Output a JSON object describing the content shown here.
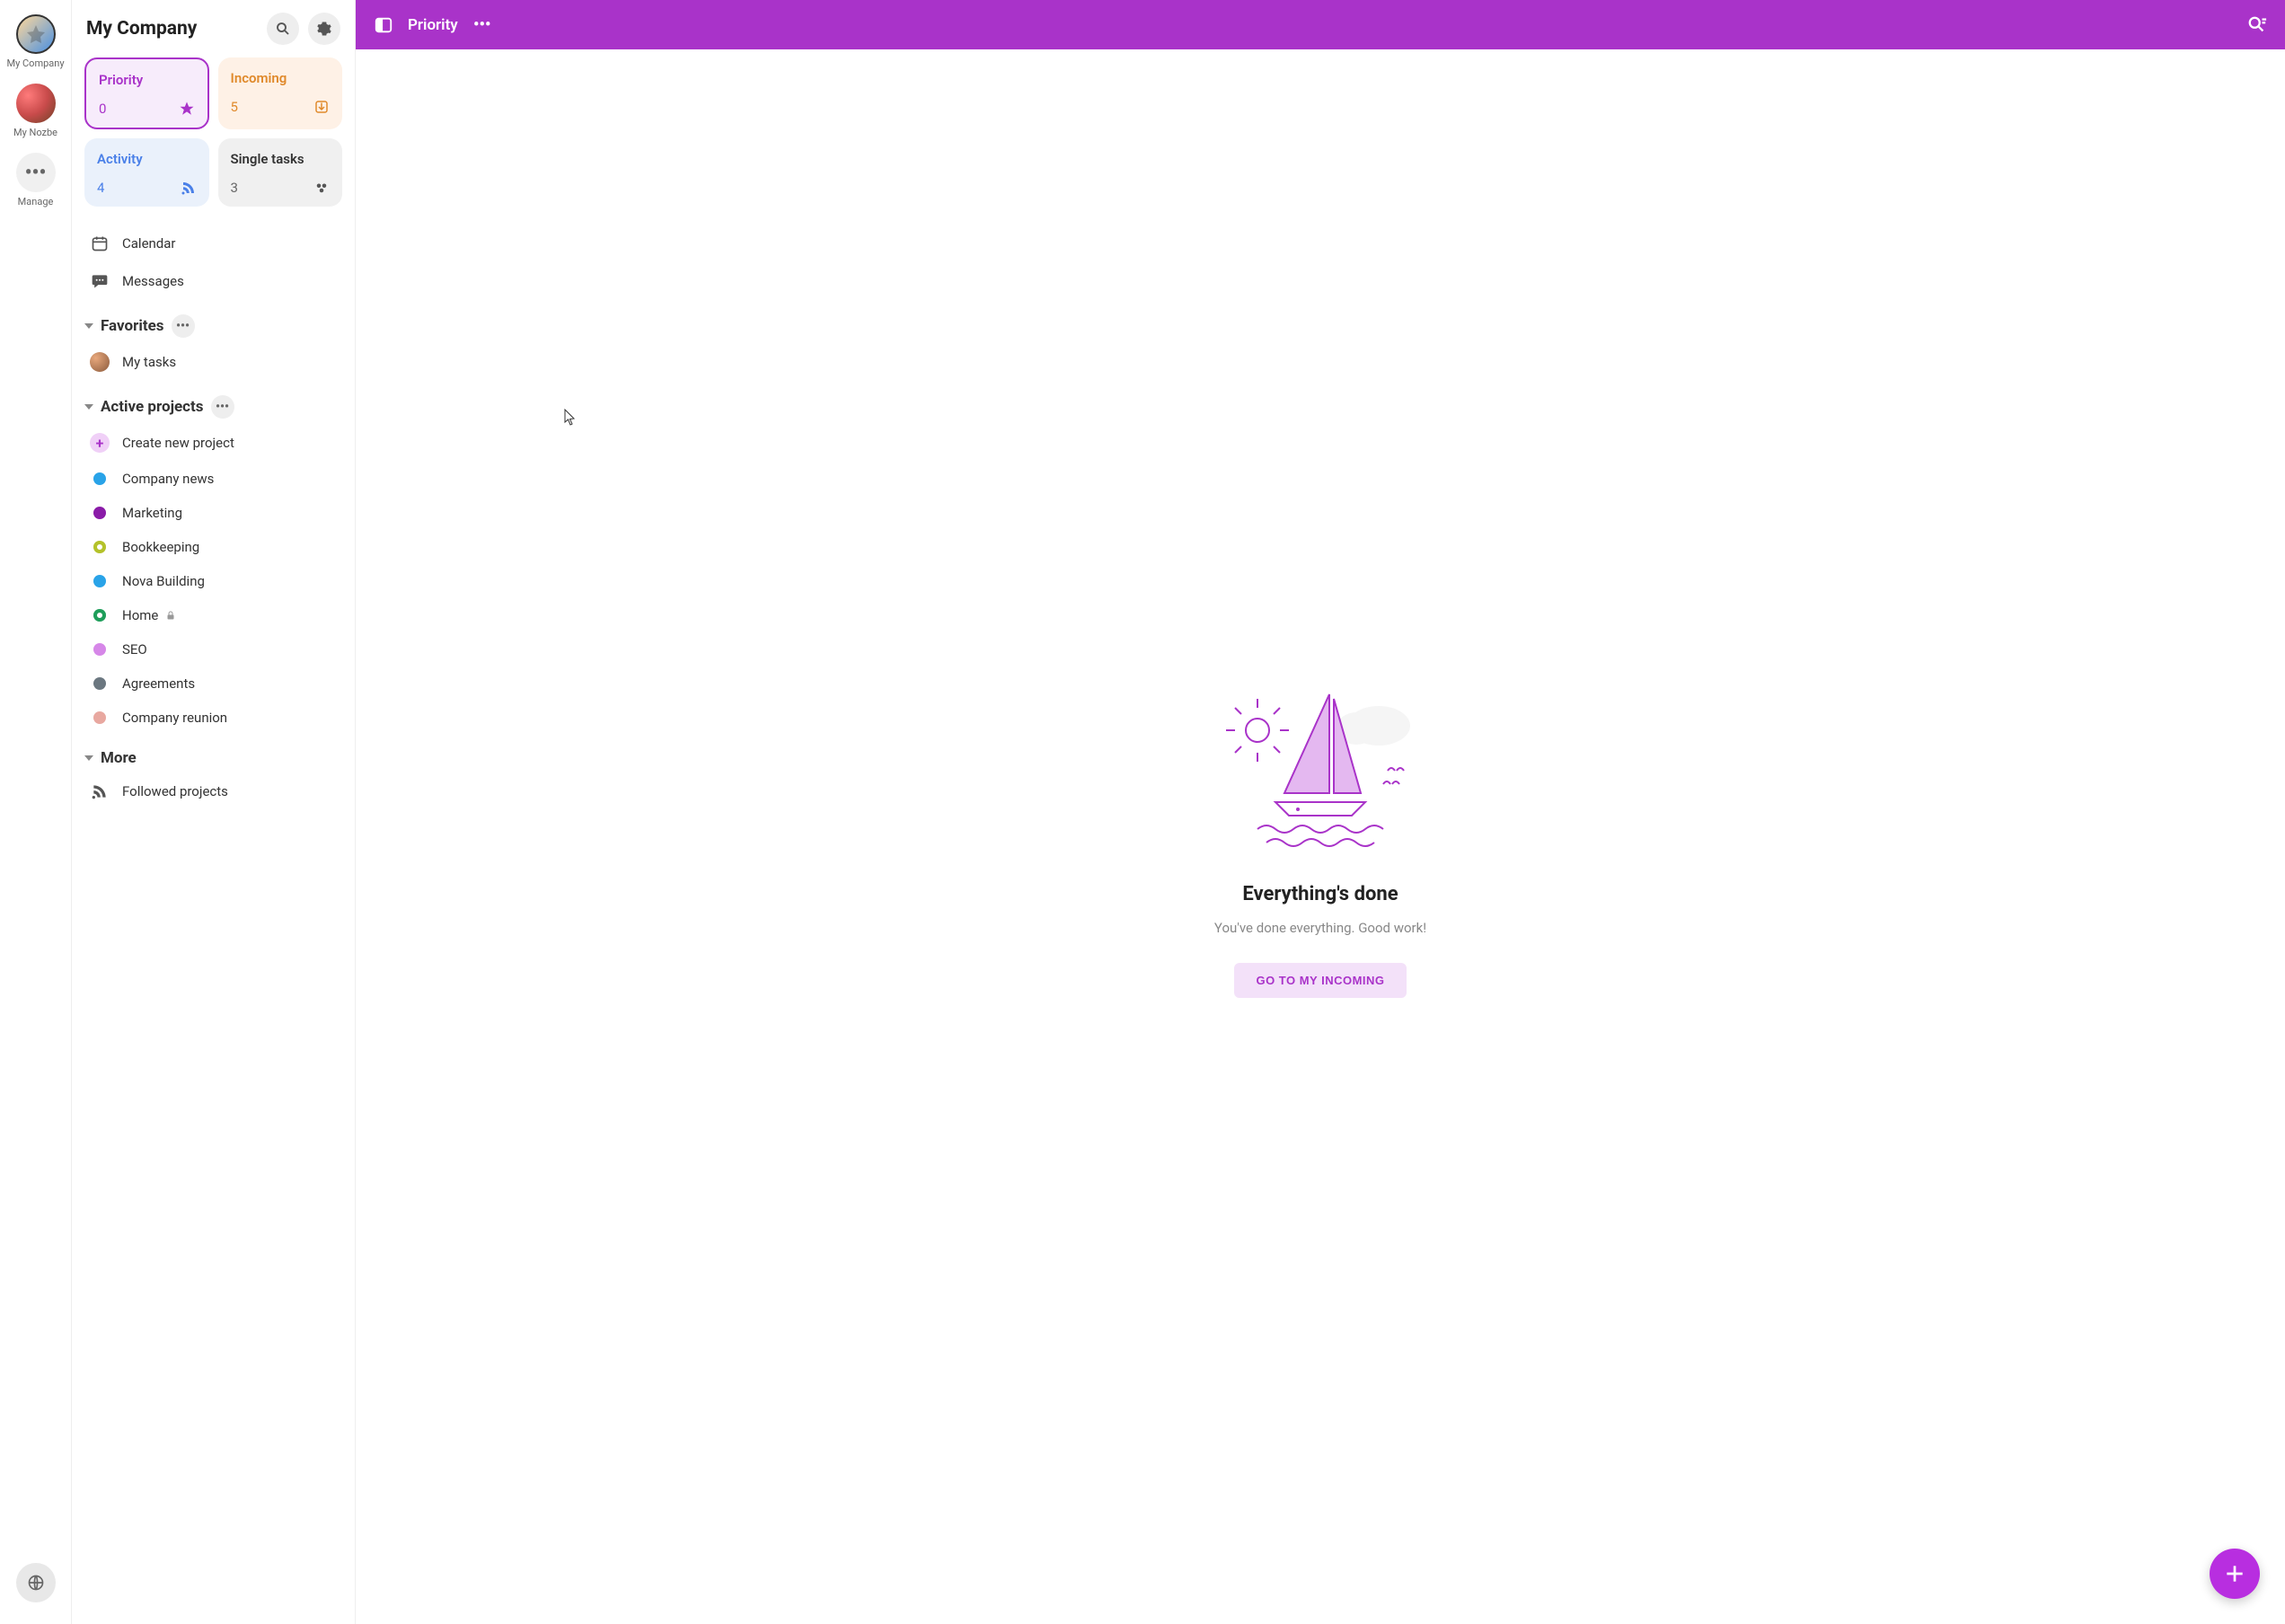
{
  "rail": {
    "company_label": "My Company",
    "nozbe_label": "My Nozbe",
    "manage_label": "Manage"
  },
  "sidebar": {
    "title": "My Company",
    "cards": {
      "priority": {
        "title": "Priority",
        "count": "0"
      },
      "incoming": {
        "title": "Incoming",
        "count": "5"
      },
      "activity": {
        "title": "Activity",
        "count": "4"
      },
      "single": {
        "title": "Single tasks",
        "count": "3"
      }
    },
    "nav": {
      "calendar": "Calendar",
      "messages": "Messages"
    },
    "favorites": {
      "title": "Favorites",
      "items": [
        {
          "label": "My tasks"
        }
      ]
    },
    "active_projects": {
      "title": "Active projects",
      "create_label": "Create new project",
      "items": [
        {
          "label": "Company news",
          "color": "#29a3e8"
        },
        {
          "label": "Marketing",
          "color": "#8a1ba8"
        },
        {
          "label": "Bookkeeping",
          "color": "#b4c22a"
        },
        {
          "label": "Nova Building",
          "color": "#29a3e8"
        },
        {
          "label": "Home",
          "color": "#1e9e5a",
          "locked": true
        },
        {
          "label": "SEO",
          "color": "#d687e8"
        },
        {
          "label": "Agreements",
          "color": "#6b7780"
        },
        {
          "label": "Company reunion",
          "color": "#e8a8a0"
        }
      ]
    },
    "more": {
      "title": "More",
      "followed": "Followed projects"
    }
  },
  "topbar": {
    "title": "Priority"
  },
  "empty": {
    "title": "Everything's done",
    "subtitle": "You've done everything. Good work!",
    "cta": "GO TO MY INCOMING"
  },
  "colors": {
    "accent": "#a933c9"
  }
}
